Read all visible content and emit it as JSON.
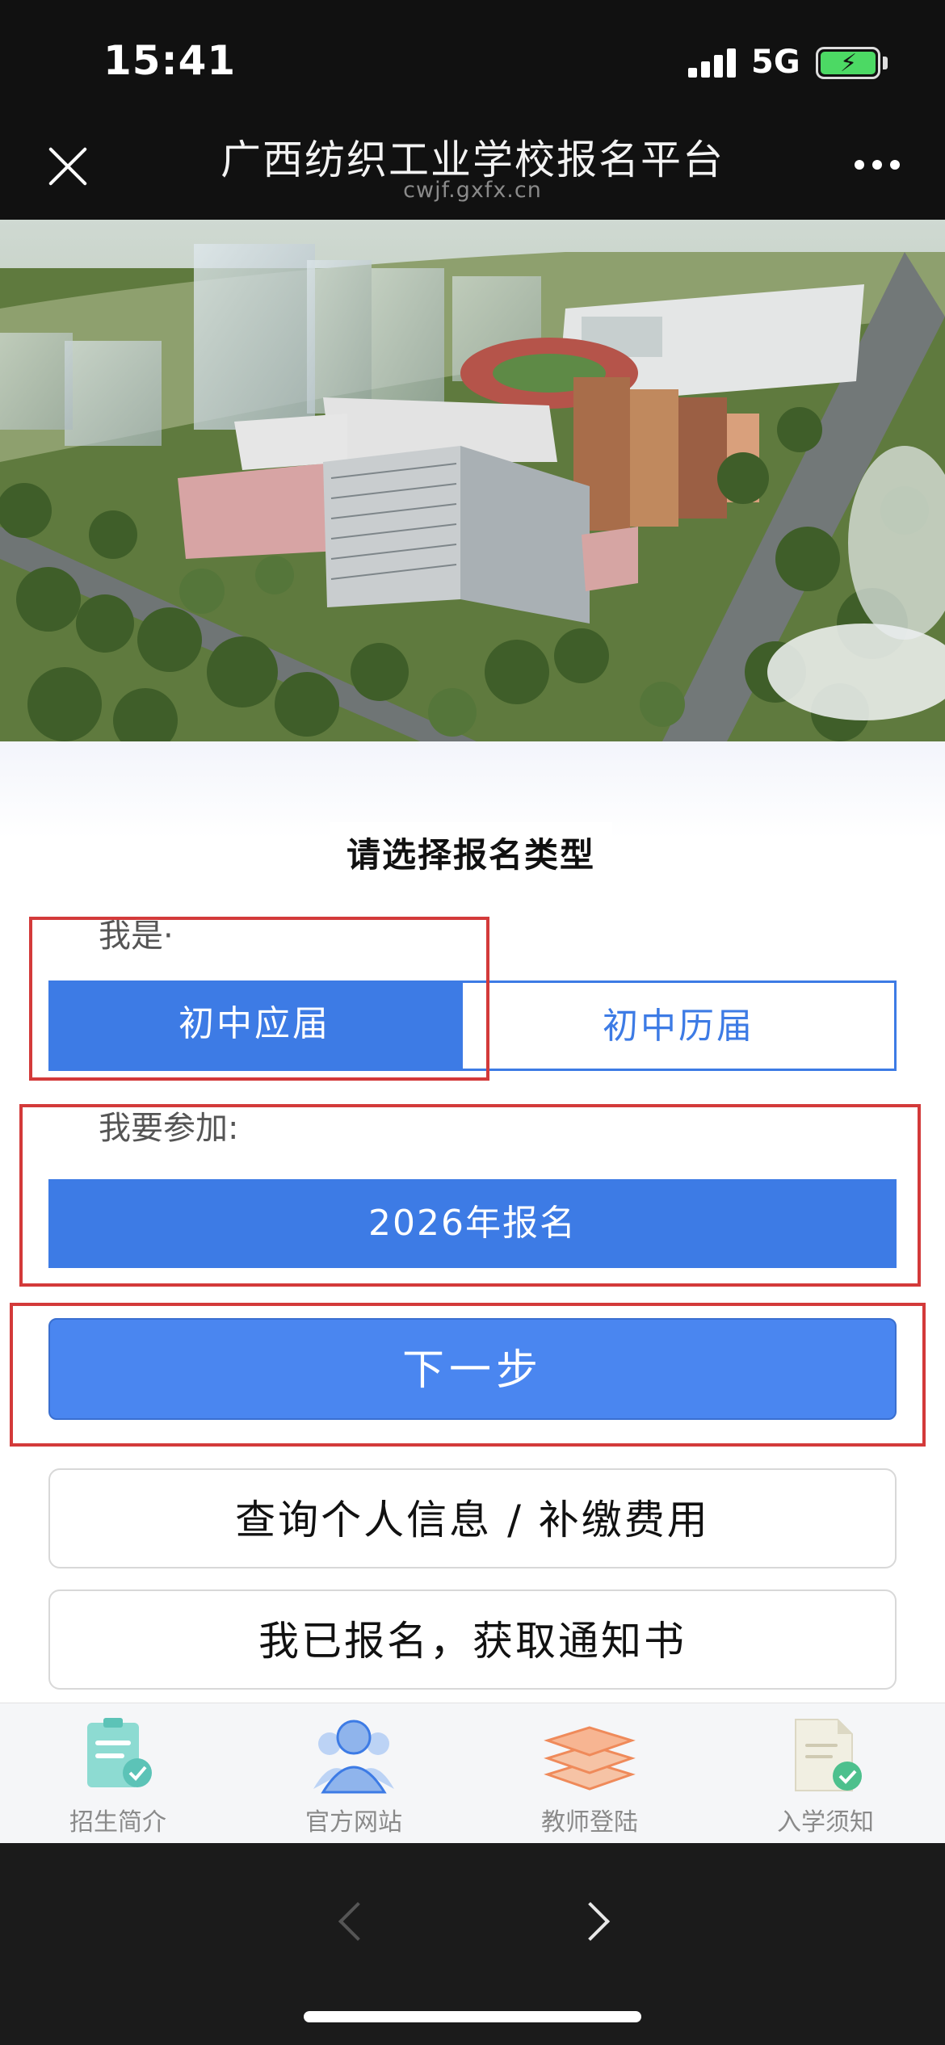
{
  "status_bar": {
    "time": "15:41",
    "network": "5G",
    "battery_icon": "battery-charging-icon"
  },
  "nav": {
    "title": "广西纺织工业学校报名平台",
    "url": "cwjf.gxfx.cn",
    "close_icon": "close-icon",
    "more_icon": "more-icon"
  },
  "form": {
    "heading": "请选择报名类型",
    "iam_label": "我是·",
    "student_types": [
      "初中应届",
      "初中历届"
    ],
    "selected_type": "初中应届",
    "join_label": "我要参加:",
    "year_option": "2026年报名",
    "next_button": "下一步",
    "query_button": "查询个人信息 / 补缴费用",
    "notice_button": "我已报名，获取通知书"
  },
  "tabs": [
    {
      "label": "招生简介",
      "icon": "clipboard-check-icon"
    },
    {
      "label": "官方网站",
      "icon": "people-icon"
    },
    {
      "label": "教师登陆",
      "icon": "layers-icon"
    },
    {
      "label": "入学须知",
      "icon": "document-check-icon"
    }
  ],
  "colors": {
    "primary": "#3d7be5",
    "highlight": "#d33a3a"
  }
}
